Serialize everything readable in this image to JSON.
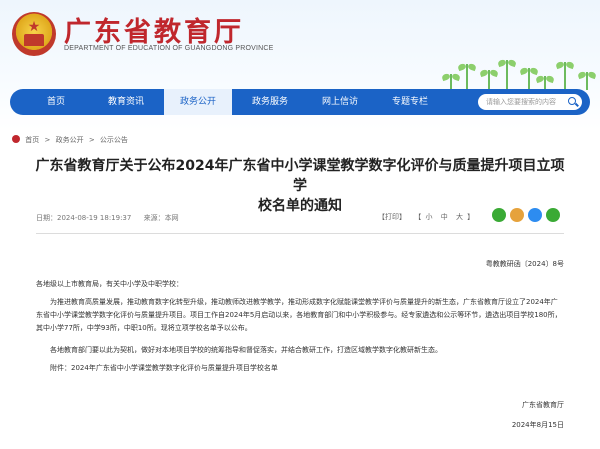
{
  "site": {
    "title": "广东省教育厅",
    "subtitle": "DEPARTMENT OF EDUCATION OF GUANGDONG PROVINCE"
  },
  "nav": {
    "items": [
      "首页",
      "教育资讯",
      "政务公开",
      "政务服务",
      "网上信访",
      "专题专栏"
    ],
    "active_index": 2,
    "search_placeholder": "请输入您要搜索的内容"
  },
  "breadcrumb": [
    "首页",
    ">",
    "政务公开",
    ">",
    "公示公告"
  ],
  "article": {
    "title_line1": "广东省教育厅关于公布2024年广东省中小学课堂教学数字化评价与质量提升项目立项学",
    "title_line2": "校名单的通知",
    "meta_date": "日期：2024-08-19 18:19:37",
    "meta_source": "来源：本网",
    "tools": [
      "【打印】",
      "【",
      "小",
      "中",
      "大",
      "】"
    ],
    "doc_number": "粤教教研函〔2024〕8号",
    "addressee": "各地级以上市教育局，有关中小学及中职学校：",
    "para1": "为推进教育高质量发展，推动教育数字化转型升级，推动教师改进教学教学，推动形成数字化赋能课堂教学评价与质量提升的新生态，广东省教育厅设立了2024年广东省中小学课堂教学数字化评价与质量提升项目。项目工作自2024年5月启动以来，各地教育部门和中小学积极参与。经专家遴选和公示等环节，遴选出项目学校180所，其中小学77所，中学93所，中职10所。现将立项学校名单予以公布。",
    "para2": "各地教育部门要以此为契机，做好对本地项目学校的统筹指导和督促落实，并结合教研工作，打造区域教学数字化教研新生态。",
    "attachment": "附件：2024年广东省中小学课堂教学数字化评价与质量提升项目学校名单",
    "sign_org": "广东省教育厅",
    "sign_date": "2024年8月15日"
  },
  "colors": {
    "brand_red": "#c0272d",
    "nav_blue": "#1b63c6",
    "share": [
      "#3aaa35",
      "#e6a23c",
      "#2d8cf0",
      "#3aaa35"
    ]
  },
  "icons": {
    "share": [
      "wechat-icon",
      "weibo-icon",
      "qq-icon",
      "qzone-icon"
    ]
  }
}
